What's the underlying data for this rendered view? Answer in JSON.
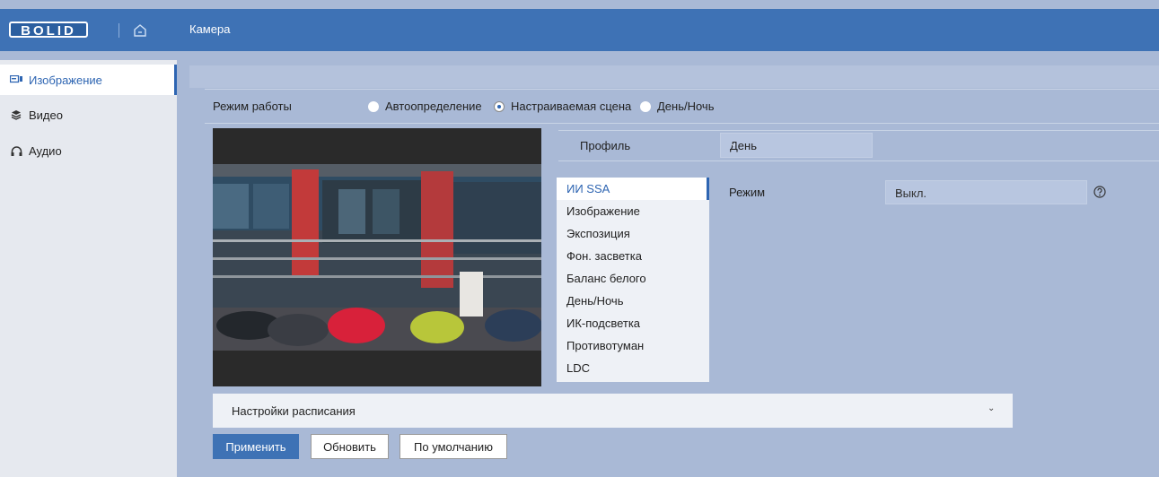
{
  "header": {
    "logo_text": "BOLID",
    "title": "Камера"
  },
  "sidebar": {
    "items": [
      {
        "label": "Изображение",
        "icon": "image-icon",
        "active": true
      },
      {
        "label": "Видео",
        "icon": "layers-icon",
        "active": false
      },
      {
        "label": "Аудио",
        "icon": "headphones-icon",
        "active": false
      }
    ]
  },
  "mode": {
    "label": "Режим работы",
    "options": [
      "Автоопределение",
      "Настраиваемая сцена",
      "День/Ночь"
    ],
    "selected": "Настраиваемая сцена"
  },
  "profile": {
    "label": "Профиль",
    "value": "День"
  },
  "menu": {
    "items": [
      "ИИ SSA",
      "Изображение",
      "Экспозиция",
      "Фон. засветка",
      "Баланс белого",
      "День/Ночь",
      "ИК-подсветка",
      "Противотуман",
      "LDC"
    ],
    "active": "ИИ SSA"
  },
  "setting": {
    "label": "Режим",
    "value": "Выкл."
  },
  "schedule": {
    "label": "Настройки расписания"
  },
  "buttons": {
    "apply": "Применить",
    "refresh": "Обновить",
    "default": "По умолчанию"
  },
  "colors": {
    "header": "#3e72b5",
    "accent": "#2e65b2",
    "background": "#a9b9d6"
  }
}
